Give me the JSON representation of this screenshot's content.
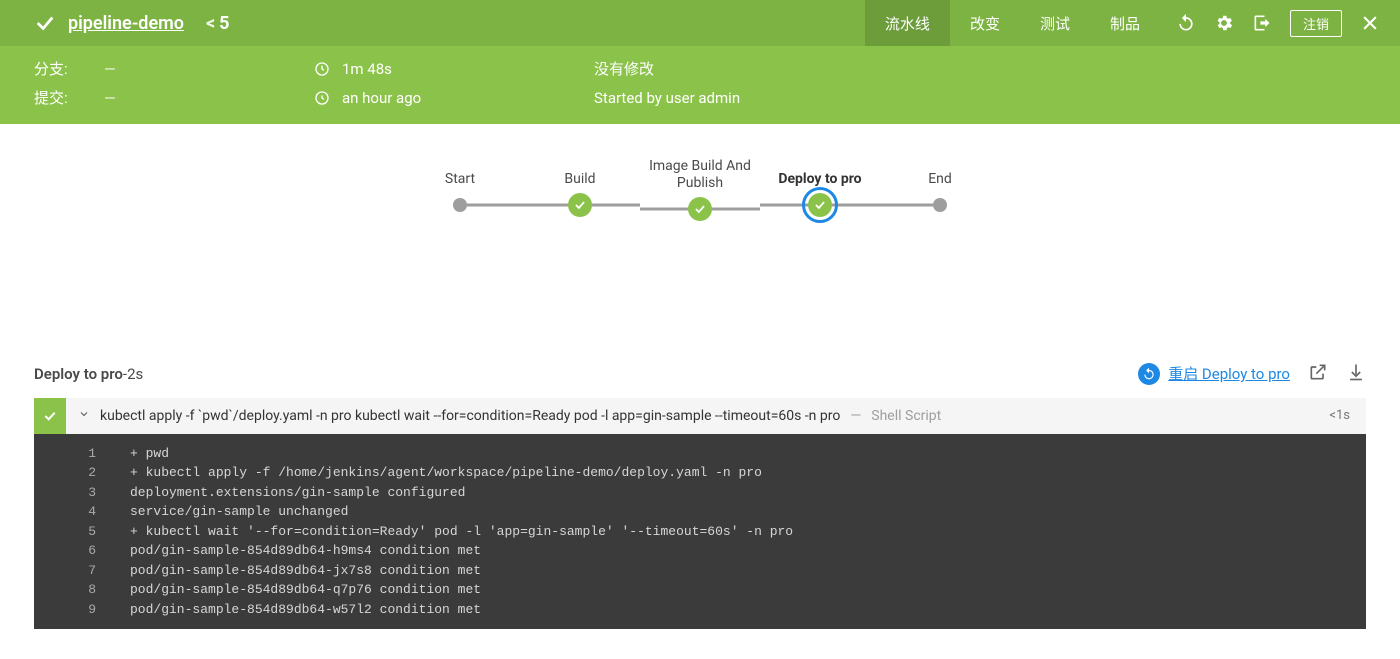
{
  "header": {
    "pipeline_name": "pipeline-demo",
    "run_number": "5",
    "tabs": [
      {
        "id": "pipeline",
        "label": "流水线",
        "active": true
      },
      {
        "id": "changes",
        "label": "改变",
        "active": false
      },
      {
        "id": "tests",
        "label": "测试",
        "active": false
      },
      {
        "id": "artifacts",
        "label": "制品",
        "active": false
      }
    ],
    "logout_label": "注销"
  },
  "info": {
    "branch_label": "分支:",
    "branch_value": "—",
    "commit_label": "提交:",
    "commit_value": "—",
    "duration": "1m 48s",
    "when": "an hour ago",
    "changes": "没有修改",
    "started_by": "Started by user admin"
  },
  "stages": [
    {
      "name": "Start",
      "type": "terminal"
    },
    {
      "name": "Build",
      "type": "success"
    },
    {
      "name": "Image Build And Publish",
      "type": "success"
    },
    {
      "name": "Deploy to pro",
      "type": "success",
      "selected": true
    },
    {
      "name": "End",
      "type": "terminal"
    }
  ],
  "step_panel": {
    "stage_name": "Deploy to pro",
    "stage_dur_sep": " - ",
    "stage_duration": "2s",
    "restart_label": "重启 Deploy to pro",
    "step": {
      "command": "kubectl apply -f `pwd`/deploy.yaml -n pro kubectl wait --for=condition=Ready pod -l app=gin-sample --timeout=60s -n pro",
      "type_sep": "  —  ",
      "type": "Shell Script",
      "duration": "<1s"
    },
    "console": [
      "+ pwd",
      "+ kubectl apply -f /home/jenkins/agent/workspace/pipeline-demo/deploy.yaml -n pro",
      "deployment.extensions/gin-sample configured",
      "service/gin-sample unchanged",
      "+ kubectl wait '--for=condition=Ready' pod -l 'app=gin-sample' '--timeout=60s' -n pro",
      "pod/gin-sample-854d89db64-h9ms4 condition met",
      "pod/gin-sample-854d89db64-jx7s8 condition met",
      "pod/gin-sample-854d89db64-q7p76 condition met",
      "pod/gin-sample-854d89db64-w57l2 condition met"
    ]
  }
}
